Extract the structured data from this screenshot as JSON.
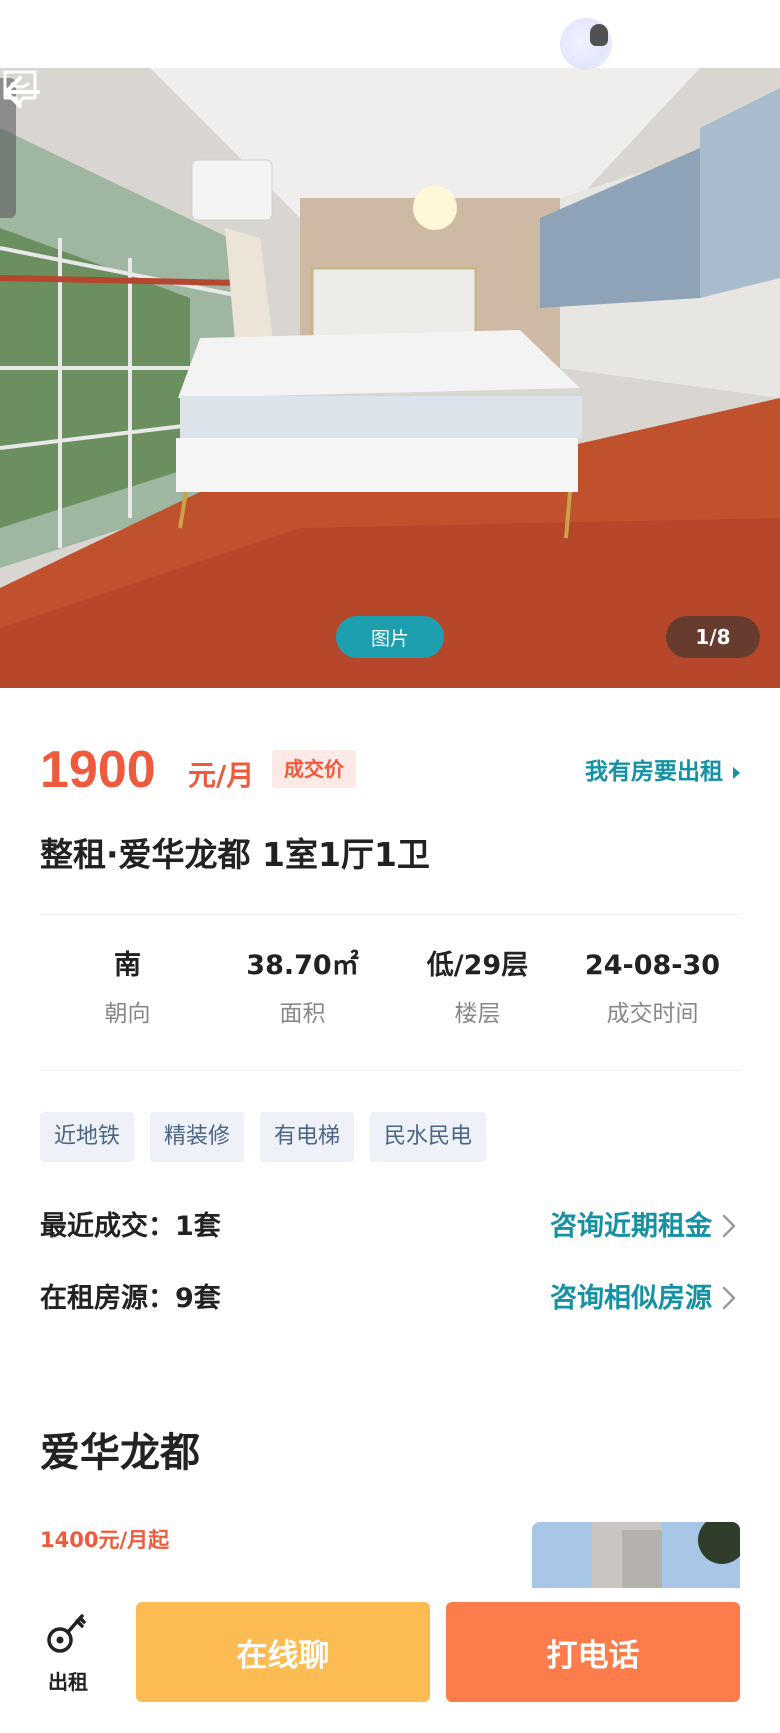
{
  "hero": {
    "photo_label": "图片",
    "photo_counter": "1/8"
  },
  "listing": {
    "price": "1900",
    "price_unit": "元/月",
    "deal_badge": "成交价",
    "rent_out_link": "我有房要出租",
    "title": "整租·爱华龙都 1室1厅1卫",
    "specs": [
      {
        "value": "南",
        "label": "朝向"
      },
      {
        "value": "38.70㎡",
        "label": "面积"
      },
      {
        "value": "低/29层",
        "label": "楼层"
      },
      {
        "value": "24-08-30",
        "label": "成交时间"
      }
    ],
    "tags": [
      "近地铁",
      "精装修",
      "有电梯",
      "民水民电"
    ],
    "recent_deals": {
      "label": "最近成交：1套",
      "action": "咨询近期租金"
    },
    "rentals": {
      "label": "在租房源：9套",
      "action": "咨询相似房源"
    }
  },
  "estate": {
    "name": "爱华龙都",
    "price_from": "1400元/月起"
  },
  "bottom_bar": {
    "rent_label": "出租",
    "chat_button": "在线聊",
    "call_button": "打电话"
  },
  "colors": {
    "accent_red": "#ef5a3c",
    "accent_teal": "#1591a4",
    "chat_orange": "#fdbb53",
    "call_orange": "#fd7c4b"
  },
  "icons": [
    "back-arrow-icon",
    "message-icon",
    "chevron-right-icon",
    "key-icon"
  ]
}
